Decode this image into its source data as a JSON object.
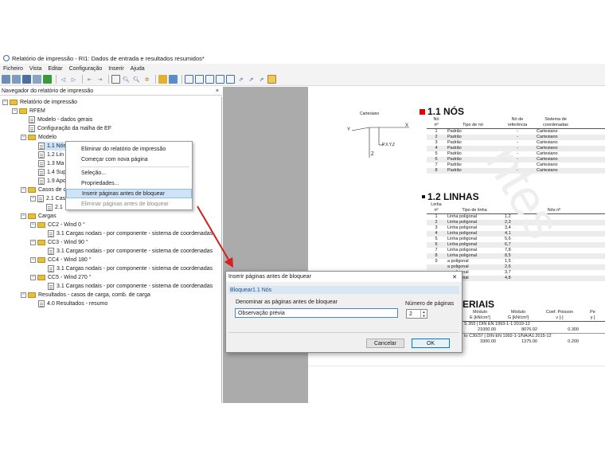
{
  "window": {
    "title": "Relatório de impressão - RI1: Dados de entrada e resultados resumidos*"
  },
  "menu": [
    "Ficheiro",
    "Vista",
    "Editar",
    "Configuração",
    "Inserir",
    "Ajuda"
  ],
  "navigator": {
    "title": "Navegador do relatório de impressão",
    "close": "×",
    "rows": [
      {
        "label": "Relatório de impressão",
        "icon": "folder",
        "expander": "−"
      },
      {
        "label": "RFEM",
        "icon": "folder",
        "expander": "−"
      },
      {
        "label": "Modelo - dados gerais",
        "icon": "page",
        "expander": ""
      },
      {
        "label": "Configuração da malha de EF",
        "icon": "page",
        "expander": ""
      },
      {
        "label": "Modelo",
        "icon": "folder",
        "expander": "−"
      },
      {
        "label": "1.1 Nós",
        "icon": "page",
        "expander": "",
        "selected": true
      },
      {
        "label": "1.2 Lin",
        "icon": "page",
        "expander": ""
      },
      {
        "label": "1.3 Ma",
        "icon": "page",
        "expander": ""
      },
      {
        "label": "1.4 Sup",
        "icon": "page",
        "expander": ""
      },
      {
        "label": "1.9 Apo",
        "icon": "page",
        "expander": ""
      },
      {
        "label": "Casos de c",
        "icon": "folder",
        "expander": "−"
      },
      {
        "label": "2.1 Cas",
        "icon": "page",
        "expander": "−"
      },
      {
        "label": "2.1",
        "icon": "page",
        "expander": ""
      },
      {
        "label": "Cargas",
        "icon": "folder",
        "expander": "−"
      },
      {
        "label": "CC2 - Wind 0 °",
        "icon": "folder",
        "expander": "−"
      },
      {
        "label": "3.1 Cargas nodais - por componente - sistema de coordenadas",
        "icon": "page",
        "expander": ""
      },
      {
        "label": "CC3 - Wind 90 °",
        "icon": "folder",
        "expander": "−"
      },
      {
        "label": "3.1 Cargas nodais - por componente - sistema de coordenadas",
        "icon": "page",
        "expander": ""
      },
      {
        "label": "CC4 - Wind 180 °",
        "icon": "folder",
        "expander": "−"
      },
      {
        "label": "3.1 Cargas nodais - por componente - sistema de coordenadas",
        "icon": "page",
        "expander": ""
      },
      {
        "label": "CC5 - Wind 270 °",
        "icon": "folder",
        "expander": "−"
      },
      {
        "label": "3.1 Cargas nodais - por componente - sistema de coordenadas",
        "icon": "page",
        "expander": ""
      },
      {
        "label": "Resultados - casos de carga, comb. de carga",
        "icon": "folder",
        "expander": "−"
      },
      {
        "label": "4.0 Resultados - resumo",
        "icon": "page",
        "expander": ""
      }
    ]
  },
  "context_menu": {
    "items": [
      {
        "label": "Eliminar do relatório de impressão",
        "state": "normal"
      },
      {
        "label": "Começar com nova página",
        "state": "normal"
      },
      {
        "label": "Seleção...",
        "state": "normal"
      },
      {
        "label": "Propriedades...",
        "state": "normal"
      },
      {
        "label": "Inserir páginas antes de bloquear",
        "state": "highlighted"
      },
      {
        "label": "Eliminar páginas antes de bloquear",
        "state": "disabled"
      }
    ]
  },
  "document": {
    "axis_label": "Cartesiano",
    "axis_x": "X",
    "axis_y": "Y",
    "axis_z": "Z",
    "axis_origin": "P.X,Y,Z",
    "nodes": {
      "title": "1.1 NÓS",
      "headers": [
        [
          "Nó",
          "nº"
        ],
        [
          "",
          "Tipo de nó"
        ],
        [
          "Nó de",
          "referência"
        ],
        [
          "Sistema de",
          "coordenadas"
        ]
      ],
      "rows": [
        [
          "1",
          "Padrão",
          "-",
          "Cartesiano"
        ],
        [
          "2",
          "Padrão",
          "-",
          "Cartesiano"
        ],
        [
          "3",
          "Padrão",
          "-",
          "Cartesiano"
        ],
        [
          "4",
          "Padrão",
          "-",
          "Cartesiano"
        ],
        [
          "5",
          "Padrão",
          "-",
          "Cartesiano"
        ],
        [
          "6",
          "Padrão",
          "-",
          "Cartesiano"
        ],
        [
          "7",
          "Padrão",
          "-",
          "Cartesiano"
        ],
        [
          "8",
          "Padrão",
          "-",
          "Cartesiano"
        ]
      ]
    },
    "lines": {
      "title": "1.2 LINHAS",
      "headers": [
        [
          "Linha",
          "nº"
        ],
        [
          "",
          "Tipo de linha"
        ],
        [
          "",
          "Nós nº"
        ]
      ],
      "rows": [
        [
          "1",
          "Linha poligonal",
          "1,2"
        ],
        [
          "2",
          "Linha poligonal",
          "2,3"
        ],
        [
          "3",
          "Linha poligonal",
          "3,4"
        ],
        [
          "4",
          "Linha poligonal",
          "4,1"
        ],
        [
          "5",
          "Linha poligonal",
          "5,6"
        ],
        [
          "6",
          "Linha poligonal",
          "6,7"
        ],
        [
          "7",
          "Linha poligonal",
          "7,8"
        ],
        [
          "8",
          "Linha poligonal",
          "8,5"
        ],
        [
          "9",
          "a poligonal",
          "1,5"
        ],
        [
          "",
          "a poligonal",
          "2,6"
        ],
        [
          "",
          "a poligonal",
          "3,7"
        ],
        [
          "",
          "a poligonal",
          "4,8"
        ]
      ]
    },
    "materials": {
      "title": "ERIAIS",
      "headers": [
        [
          "Módulo",
          "E [kN/cm²]"
        ],
        [
          "Módulo",
          "G [kN/cm²]"
        ],
        [
          "Coef. Poisson",
          "ν [-]"
        ],
        [
          "Pe",
          "γ ["
        ]
      ],
      "row1_desc": "S 355 | DIN EN 1993-1-1:2010-12",
      "row1": [
        "21000.00",
        "8076.92",
        "0.300",
        ""
      ],
      "row2_desc": "to C30/37 | DIN EN 1992-1-1/NA/A1:2015-12",
      "row2": [
        "3300.00",
        "1375.00",
        "0.200",
        ""
      ]
    },
    "watermark": "ntes"
  },
  "dialog": {
    "title": "Inserir páginas antes de bloquear",
    "close": "✕",
    "group": "Bloquear1.1 Nós",
    "name_label": "Denominar as páginas antes de bloquear",
    "name_value": "Observação prévia",
    "count_label": "Número de páginas",
    "count_value": "2",
    "cancel": "Cancelar",
    "ok": "OK"
  },
  "colors": {
    "accent": "#0078d7",
    "highlight": "#cfe3f8",
    "arrow": "#d42020",
    "marker": "#e60000"
  }
}
